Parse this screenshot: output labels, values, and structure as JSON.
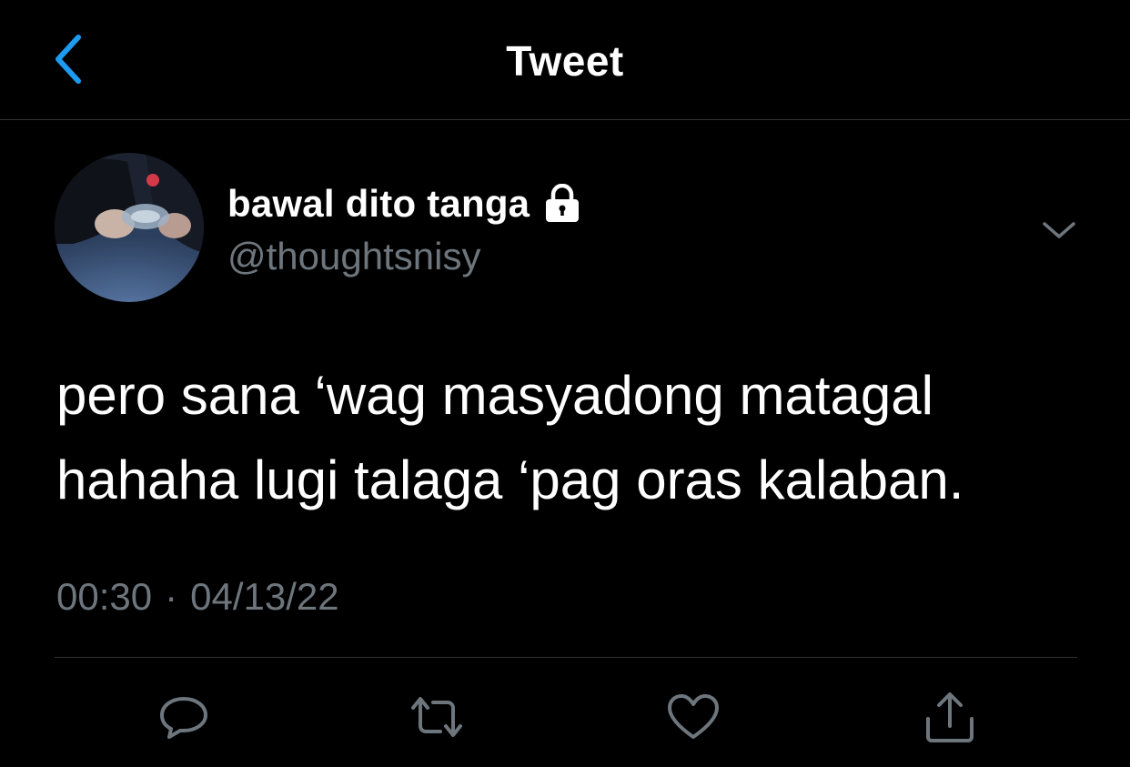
{
  "header": {
    "title": "Tweet",
    "back_icon": "chevron-left-icon"
  },
  "author": {
    "display_name": "bawal dito tanga",
    "handle": "@thoughtsnisy",
    "protected_icon": "lock-icon"
  },
  "tweet": {
    "lines": [
      "pero sana ‘wag masyadong matagal",
      "hahaha lugi talaga ‘pag oras kalaban."
    ],
    "time": "00:30",
    "separator": "·",
    "date": "04/13/22"
  },
  "actions": {
    "reply_icon": "reply-icon",
    "retweet_icon": "retweet-icon",
    "like_icon": "heart-icon",
    "share_icon": "share-icon"
  },
  "colors": {
    "background": "#000000",
    "accent": "#1d9bf0",
    "muted": "#6e767d",
    "divider": "#2f3336"
  }
}
